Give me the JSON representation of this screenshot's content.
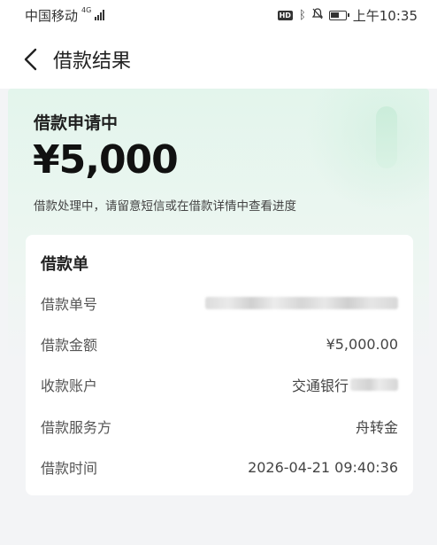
{
  "status_bar": {
    "carrier": "中国移动",
    "network": "4G",
    "time": "上午10:35",
    "icons": [
      "hd-icon",
      "bluetooth-icon",
      "mute-icon",
      "battery-icon"
    ]
  },
  "nav": {
    "back_icon": "chevron-left-icon",
    "title": "借款结果"
  },
  "result": {
    "status_title": "借款申请中",
    "amount": "¥5,000",
    "note": "借款处理中，请留意短信或在借款详情中查看进度"
  },
  "card": {
    "title": "借款单",
    "rows": [
      {
        "label": "借款单号",
        "value": ""
      },
      {
        "label": "借款金额",
        "value": "¥5,000.00"
      },
      {
        "label": "收款账户",
        "value": "交通银行"
      },
      {
        "label": "借款服务方",
        "value": "舟转金"
      },
      {
        "label": "借款时间",
        "value": "2026-04-21 09:40:36"
      }
    ]
  },
  "colors": {
    "hero_green": "#e3f5ec",
    "background": "#f3f4f6",
    "card": "#ffffff"
  }
}
